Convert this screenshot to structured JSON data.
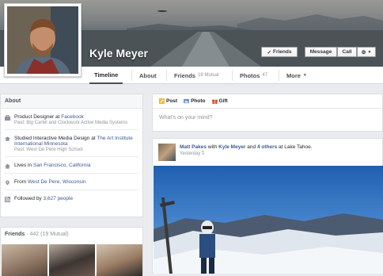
{
  "profile": {
    "name": "Kyle Meyer"
  },
  "actions": {
    "friends": "Friends",
    "message": "Message",
    "call": "Call"
  },
  "tabs": [
    {
      "label": "Timeline",
      "sub": ""
    },
    {
      "label": "About",
      "sub": ""
    },
    {
      "label": "Friends",
      "sub": "19 Mutual"
    },
    {
      "label": "Photos",
      "sub": "47"
    },
    {
      "label": "More",
      "sub": ""
    }
  ],
  "about": {
    "title": "About",
    "work": {
      "prefix": "Product Designer at ",
      "link": "Facebook",
      "past": "Past: Big Cartel and Clockwork Active Media Systems"
    },
    "edu": {
      "prefix": "Studied Interactive Media Design at ",
      "link": "The Art Institute International Minnesota",
      "past": "Past: West De Pere High School"
    },
    "lives": {
      "prefix": "Lives in ",
      "link": "San Francisco, California"
    },
    "from": {
      "prefix": "From ",
      "link": "West De Pere, Wisconsin"
    },
    "followers": {
      "prefix": "Followed by ",
      "link": "3,627 people"
    }
  },
  "friends_panel": {
    "title": "Friends",
    "count": "· 442 (19 Mutual)"
  },
  "composer": {
    "post": "Post",
    "photo": "Photo",
    "gift": "Gift",
    "placeholder": "What's on your mind?"
  },
  "story": {
    "author": "Matt Pakes",
    "with": " with ",
    "tagged": "Kyle Meyer",
    "and": " and ",
    "others": "4 others",
    "at": " at Lake Tahoe.",
    "time": "Yesterday"
  }
}
